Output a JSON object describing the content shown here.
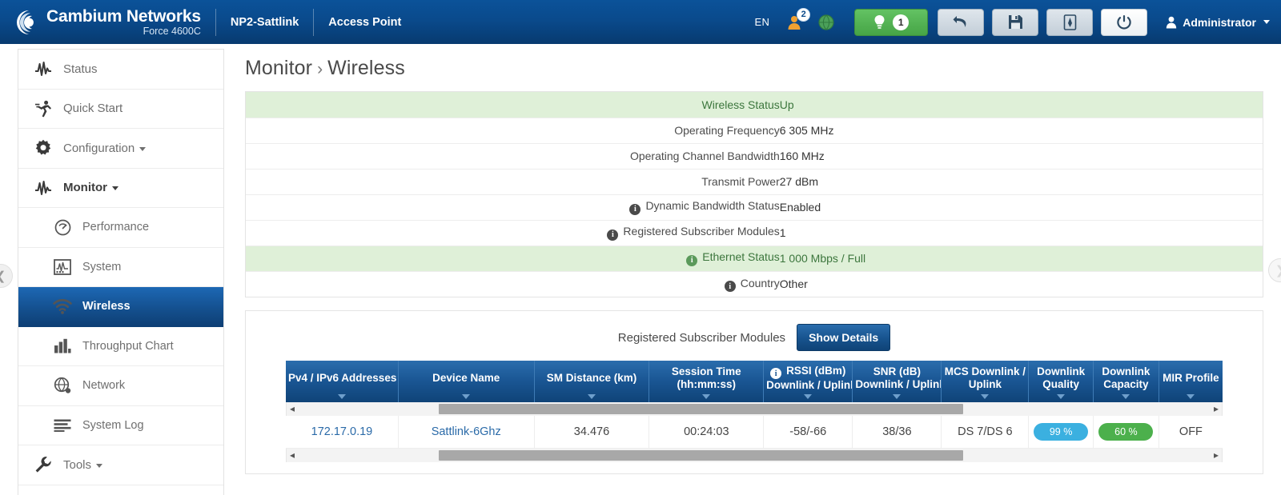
{
  "topbar": {
    "brand_name": "Cambium Networks",
    "brand_model": "Force 4600C",
    "device_name": "NP2-Sattlink",
    "device_role": "Access Point",
    "language": "EN",
    "users_icon": "user-icon",
    "users_badge": "2",
    "globe_icon": "globe-icon",
    "alarm_icon": "alarm-bulb-icon",
    "alarm_count": "1",
    "undo_icon": "undo-icon",
    "save_icon": "save-icon",
    "export_icon": "export-icon",
    "power_icon": "power-icon",
    "user_icon": "person-icon",
    "user_label": "Administrator"
  },
  "sidebar": {
    "items": [
      {
        "label": "Status",
        "icon": "pulse-icon",
        "level": "top",
        "caret": false,
        "active": false
      },
      {
        "label": "Quick Start",
        "icon": "runner-icon",
        "level": "top",
        "caret": false,
        "active": false
      },
      {
        "label": "Configuration",
        "icon": "gear-icon",
        "level": "top",
        "caret": true,
        "active": false
      },
      {
        "label": "Monitor",
        "icon": "pulse-icon",
        "level": "top",
        "caret": true,
        "active": false,
        "bold": true
      },
      {
        "label": "Performance",
        "icon": "gauge-icon",
        "level": "sub",
        "caret": false,
        "active": false
      },
      {
        "label": "System",
        "icon": "monitor-icon",
        "level": "sub",
        "caret": false,
        "active": false
      },
      {
        "label": "Wireless",
        "icon": "wifi-icon",
        "level": "sub",
        "caret": false,
        "active": true
      },
      {
        "label": "Throughput Chart",
        "icon": "bar-chart-icon",
        "level": "sub",
        "caret": false,
        "active": false
      },
      {
        "label": "Network",
        "icon": "network-globe-icon",
        "level": "sub",
        "caret": false,
        "active": false
      },
      {
        "label": "System Log",
        "icon": "list-icon",
        "level": "sub",
        "caret": false,
        "active": false
      },
      {
        "label": "Tools",
        "icon": "wrench-icon",
        "level": "top",
        "caret": true,
        "active": false
      }
    ],
    "collapse_icon": "chevron-left-icon",
    "expand_icon": "chevron-right-icon"
  },
  "breadcrumb": {
    "parent": "Monitor",
    "separator": "›",
    "current": "Wireless"
  },
  "status_table": {
    "rows": [
      {
        "label": "Wireless Status",
        "value": "Up",
        "info": false,
        "highlight": true
      },
      {
        "label": "Operating Frequency",
        "value": "6 305 MHz",
        "info": false,
        "highlight": false
      },
      {
        "label": "Operating Channel Bandwidth",
        "value": "160 MHz",
        "info": false,
        "highlight": false
      },
      {
        "label": "Transmit Power",
        "value": "27 dBm",
        "info": false,
        "highlight": false
      },
      {
        "label": "Dynamic Bandwidth Status",
        "value": "Enabled",
        "info": true,
        "highlight": false
      },
      {
        "label": "Registered Subscriber Modules",
        "value": "1",
        "info": true,
        "highlight": false
      },
      {
        "label": "Ethernet Status",
        "value": "1 000 Mbps / Full",
        "info": true,
        "highlight": true
      },
      {
        "label": "Country",
        "value": "Other",
        "info": true,
        "highlight": false
      }
    ]
  },
  "subscriber_panel": {
    "title": "Registered Subscriber Modules",
    "show_details_label": "Show Details",
    "columns": [
      {
        "line1": "Pv4 / IPv6 Addresses",
        "line2": "",
        "info": false
      },
      {
        "line1": "Device Name",
        "line2": "",
        "info": false
      },
      {
        "line1": "SM Distance (km)",
        "line2": "",
        "info": false
      },
      {
        "line1": "Session Time",
        "line2": "(hh:mm:ss)",
        "info": false
      },
      {
        "line1": "RSSI (dBm)",
        "line2": "Downlink / Uplink",
        "info": true
      },
      {
        "line1": "SNR (dB)",
        "line2": "Downlink / Uplink",
        "info": false
      },
      {
        "line1": "MCS Downlink /",
        "line2": "Uplink",
        "info": false
      },
      {
        "line1": "Downlink",
        "line2": "Quality",
        "info": false
      },
      {
        "line1": "Downlink",
        "line2": "Capacity",
        "info": false
      },
      {
        "line1": "MIR Profile",
        "line2": "",
        "info": false
      }
    ],
    "rows": [
      {
        "ip": "172.17.0.19",
        "device_name": "Sattlink-6Ghz",
        "sm_distance": "34.476",
        "session_time": "00:24:03",
        "rssi": "-58/-66",
        "snr": "38/36",
        "mcs": "DS 7/DS 6",
        "downlink_quality": "99 %",
        "downlink_capacity": "60 %",
        "mir_profile": "OFF"
      }
    ],
    "scroll_left_arrow": "◂",
    "scroll_right_arrow": "▸"
  },
  "colors": {
    "header_blue": "#0a4a8c",
    "accent_blue": "#1a5694",
    "row_green": "#dff0d8",
    "green_text": "#3c763d",
    "badge_blue": "#3bb0e0",
    "badge_green": "#4cb04c",
    "alarm_green": "#46a546"
  }
}
